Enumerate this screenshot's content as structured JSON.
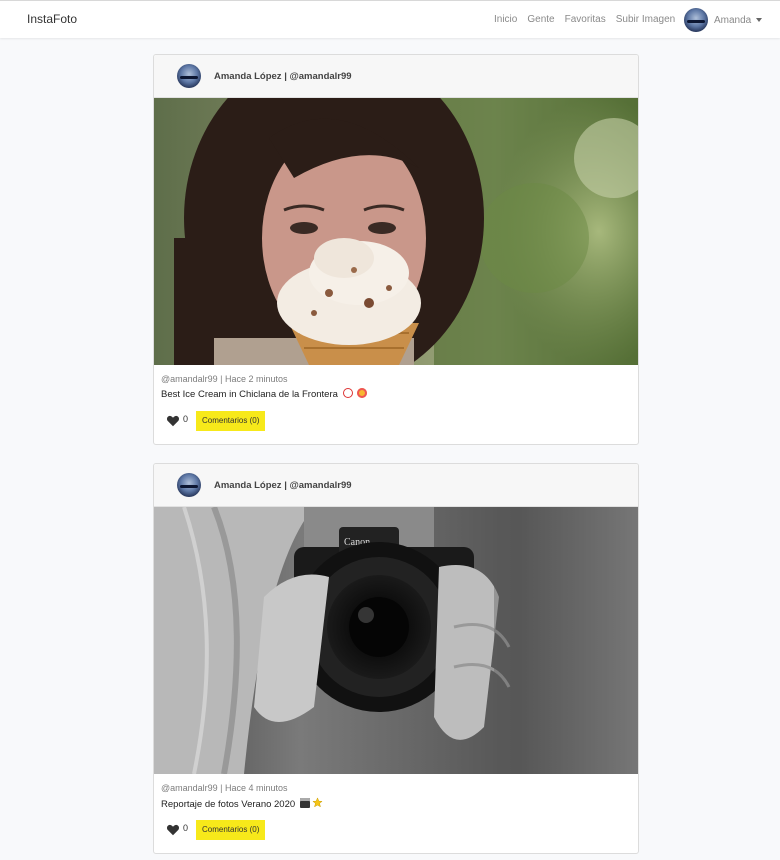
{
  "nav": {
    "brand": "InstaFoto",
    "links": [
      "Inicio",
      "Gente",
      "Favoritas",
      "Subir Imagen"
    ],
    "user": "Amanda"
  },
  "posts": [
    {
      "author": "Amanda López | @amandalr99",
      "meta": "@amandalr99 | Hace 2 minutos",
      "description": "Best Ice Cream in Chiclana de la Frontera",
      "likes": "0",
      "comments_label": "Comentarios (0)",
      "emoji_icons": [
        "alarm-clock-icon",
        "heart-eyes-face-icon"
      ]
    },
    {
      "author": "Amanda López | @amandalr99",
      "meta": "@amandalr99 | Hace 4 minutos",
      "description": "Reportaje de fotos Verano 2020",
      "likes": "0",
      "comments_label": "Comentarios (0)",
      "emoji_icons": [
        "clapper-board-icon",
        "star-icon"
      ]
    }
  ],
  "colors": {
    "accent": "#f7e91a",
    "heart": "#333333"
  }
}
